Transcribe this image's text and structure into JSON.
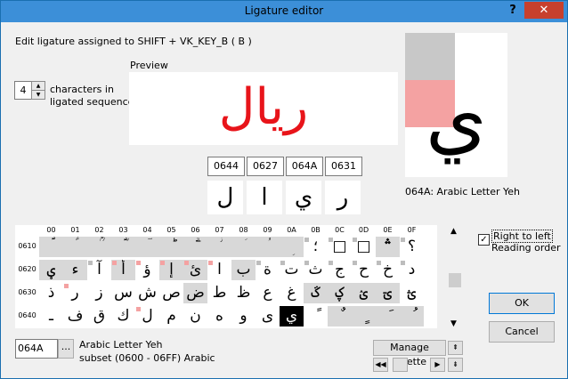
{
  "window": {
    "title": "Ligature editor",
    "help": "?",
    "close": "✕"
  },
  "header": {
    "assign_text": "Edit ligature assigned to SHIFT + VK_KEY_B ( B )"
  },
  "preview": {
    "label": "Preview",
    "text": "ريال"
  },
  "count": {
    "value": "4",
    "label_line1": "characters in",
    "label_line2": "ligated sequence"
  },
  "sequence": {
    "codes": [
      "0644",
      "0627",
      "064A",
      "0631"
    ],
    "chars": [
      "ل",
      "ا",
      "ي",
      "ر"
    ]
  },
  "big_char": {
    "glyph": "ي",
    "caption": "064A: Arabic Letter Yeh"
  },
  "grid": {
    "columns": [
      "00",
      "01",
      "02",
      "03",
      "04",
      "05",
      "06",
      "07",
      "08",
      "09",
      "0A",
      "0B",
      "0C",
      "0D",
      "0E",
      "0F"
    ],
    "rows": [
      {
        "label": "0610",
        "cells": [
          "ؐ",
          "ؑ",
          "ؒ",
          "ؓ",
          "ؔ",
          "ؕ",
          "ؖ",
          "ؗ",
          "ؘ",
          "ؙ",
          "ؚ",
          "؛",
          "□",
          "□",
          "؞",
          "؟"
        ]
      },
      {
        "label": "0620",
        "cells": [
          "ؠ",
          "ء",
          "آ",
          "أ",
          "ؤ",
          "إ",
          "ئ",
          "ا",
          "ب",
          "ة",
          "ت",
          "ث",
          "ج",
          "ح",
          "خ",
          "د"
        ]
      },
      {
        "label": "0630",
        "cells": [
          "ذ",
          "ر",
          "ز",
          "س",
          "ش",
          "ص",
          "ض",
          "ط",
          "ظ",
          "ع",
          "غ",
          "ػ",
          "ؼ",
          "ؽ",
          "ؾ",
          "ؿ"
        ]
      },
      {
        "label": "0640",
        "cells": [
          "ـ",
          "ف",
          "ق",
          "ك",
          "ل",
          "م",
          "ن",
          "ه",
          "و",
          "ى",
          "ي",
          "ً",
          "ٌ",
          "ٍ",
          "َ",
          "ُ"
        ]
      }
    ]
  },
  "rtl": {
    "label_line1": "Right to left",
    "label_line2": "Reading order",
    "checked": "✓"
  },
  "buttons": {
    "ok": "OK",
    "cancel": "Cancel",
    "manage": "Manage Palette",
    "dots": "...",
    "up": "▲",
    "down": "▼",
    "first": "◀◀",
    "next": "▶",
    "scroll_top": "⇞",
    "scroll_bottom": "⇟"
  },
  "code_input": {
    "value": "064A"
  },
  "info": {
    "name": "Arabic Letter Yeh",
    "subset": "subset (0600 - 06FF) Arabic"
  },
  "colors": {
    "accent": "#e8141a",
    "gray_cell": "#d8d8d8",
    "pink_mark": "#f4a2a2"
  }
}
